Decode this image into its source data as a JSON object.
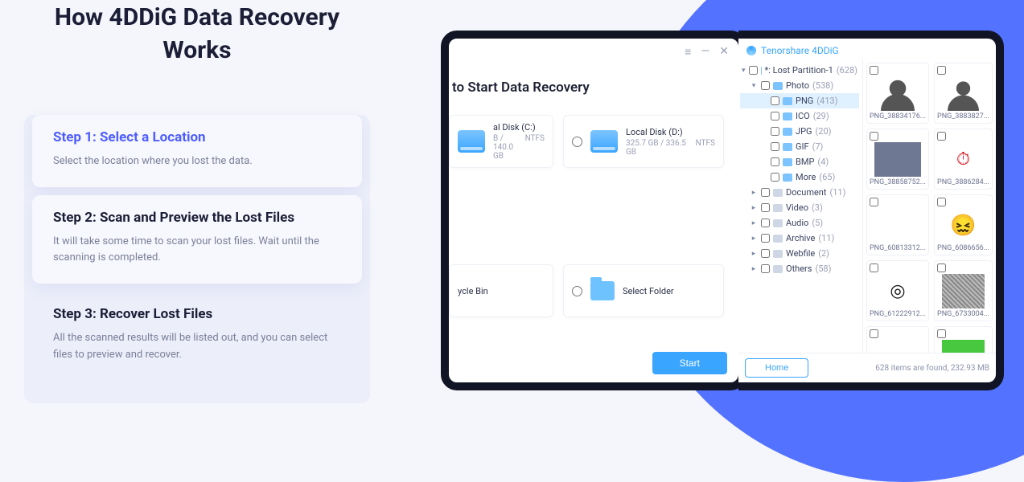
{
  "headline": "How 4DDiG Data Recovery Works",
  "steps": [
    {
      "title": "Step 1: Select a Location",
      "desc": "Select the location where you lost the data."
    },
    {
      "title": "Step 2: Scan and Preview the Lost Files",
      "desc": "It will take some time to scan your lost files. Wait until the scanning is completed."
    },
    {
      "title": "Step 3: Recover Lost Files",
      "desc": "All the scanned results will be listed out, and you can select files to preview and recover."
    }
  ],
  "win_left": {
    "title_fragment": " to Start Data Recovery",
    "disk_c": {
      "name": "al Disk (C:)",
      "used": "B / 140.0 GB",
      "fs": "NTFS"
    },
    "disk_d": {
      "name": "Local Disk (D:)",
      "used": "325.7 GB / 336.5 GB",
      "fs": "NTFS"
    },
    "recycle": "ycle Bin",
    "select_folder": "Select Folder",
    "start": "Start"
  },
  "win_right": {
    "app_title": "Tenorshare 4DDiG",
    "root": {
      "label": "*: Lost Partition-1",
      "count": "(628)"
    },
    "photo": {
      "label": "Photo",
      "count": "(538)"
    },
    "photo_children": [
      {
        "label": "PNG",
        "count": "(413)",
        "selected": true
      },
      {
        "label": "ICO",
        "count": "(29)"
      },
      {
        "label": "JPG",
        "count": "(20)"
      },
      {
        "label": "GIF",
        "count": "(7)"
      },
      {
        "label": "BMP",
        "count": "(4)"
      },
      {
        "label": "More",
        "count": "(65)"
      }
    ],
    "siblings": [
      {
        "label": "Document",
        "count": "(11)"
      },
      {
        "label": "Video",
        "count": "(3)"
      },
      {
        "label": "Audio",
        "count": "(5)"
      },
      {
        "label": "Archive",
        "count": "(11)"
      },
      {
        "label": "Webfile",
        "count": "(2)"
      },
      {
        "label": "Others",
        "count": "(58)"
      }
    ],
    "thumbs": [
      {
        "cap": "PNG_38834176...",
        "kind": "avatar1"
      },
      {
        "cap": "PNG_3883827...",
        "kind": "avatar2"
      },
      {
        "cap": "PNG_38858752...",
        "kind": "gray"
      },
      {
        "cap": "PNG_3886284...",
        "kind": "clock",
        "glyph": "⏱"
      },
      {
        "cap": "PNG_60813312...",
        "kind": "blank"
      },
      {
        "cap": "PNG_6086656...",
        "kind": "emoji",
        "glyph": "😖"
      },
      {
        "cap": "PNG_61222912...",
        "kind": "disc",
        "glyph": "◎"
      },
      {
        "cap": "PNG_6733004...",
        "kind": "noise"
      },
      {
        "cap": "",
        "kind": "blank"
      },
      {
        "cap": "",
        "kind": "green"
      }
    ],
    "status": "628 items are found, 232.93 MB",
    "home": "Home"
  }
}
